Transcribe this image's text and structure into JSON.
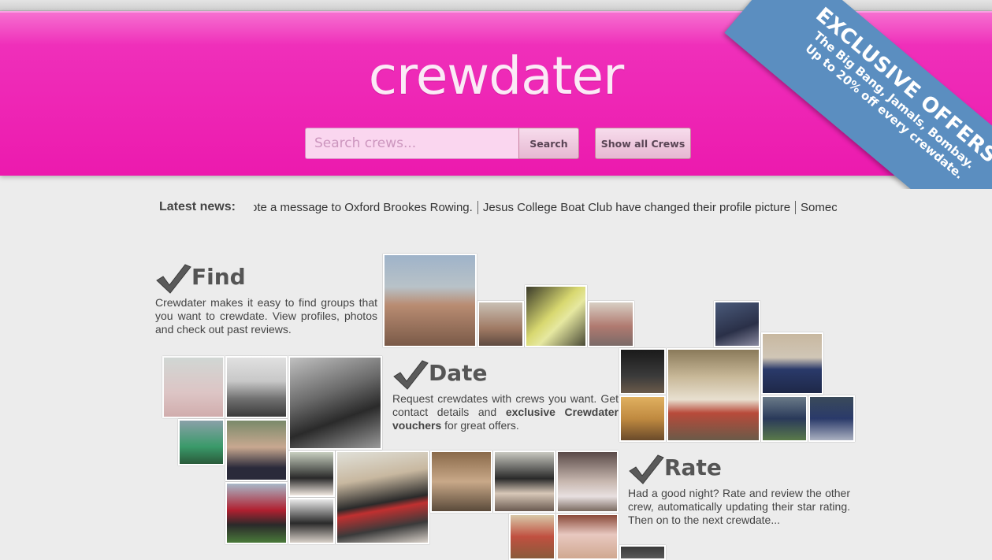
{
  "header": {
    "logo": "crewdater",
    "search_placeholder": "Search crews...",
    "search_button": "Search",
    "show_all_button": "Show all Crews"
  },
  "ribbon": {
    "title": "EXCLUSIVE OFFERS",
    "line1": "The Big Bang, Jamals, Bombay.",
    "line2": "Up to 20% off every crewdate."
  },
  "news": {
    "label": "Latest news:",
    "items": [
      "rote a message to Oxford Brookes Rowing.",
      "Jesus College Boat Club have changed their profile picture",
      "Somec"
    ]
  },
  "features": {
    "find": {
      "title": "Find",
      "text": "Crewdater makes it easy to find groups that you want to crewdate. View profiles, photos and check out past reviews."
    },
    "date": {
      "title": "Date",
      "text_before": "Request crewdates with crews you want. Get contact details and ",
      "bold": "exclusive Crewdater vouchers",
      "text_after": " for great offers."
    },
    "rate": {
      "title": "Rate",
      "text": "Had a good night? Rate and review the other crew, automatically updating their star rating. Then on to the next crewdate..."
    }
  },
  "colors": {
    "header_pink": "#ec1aae",
    "ribbon_blue": "#5b8ec0",
    "background": "#ececec"
  }
}
